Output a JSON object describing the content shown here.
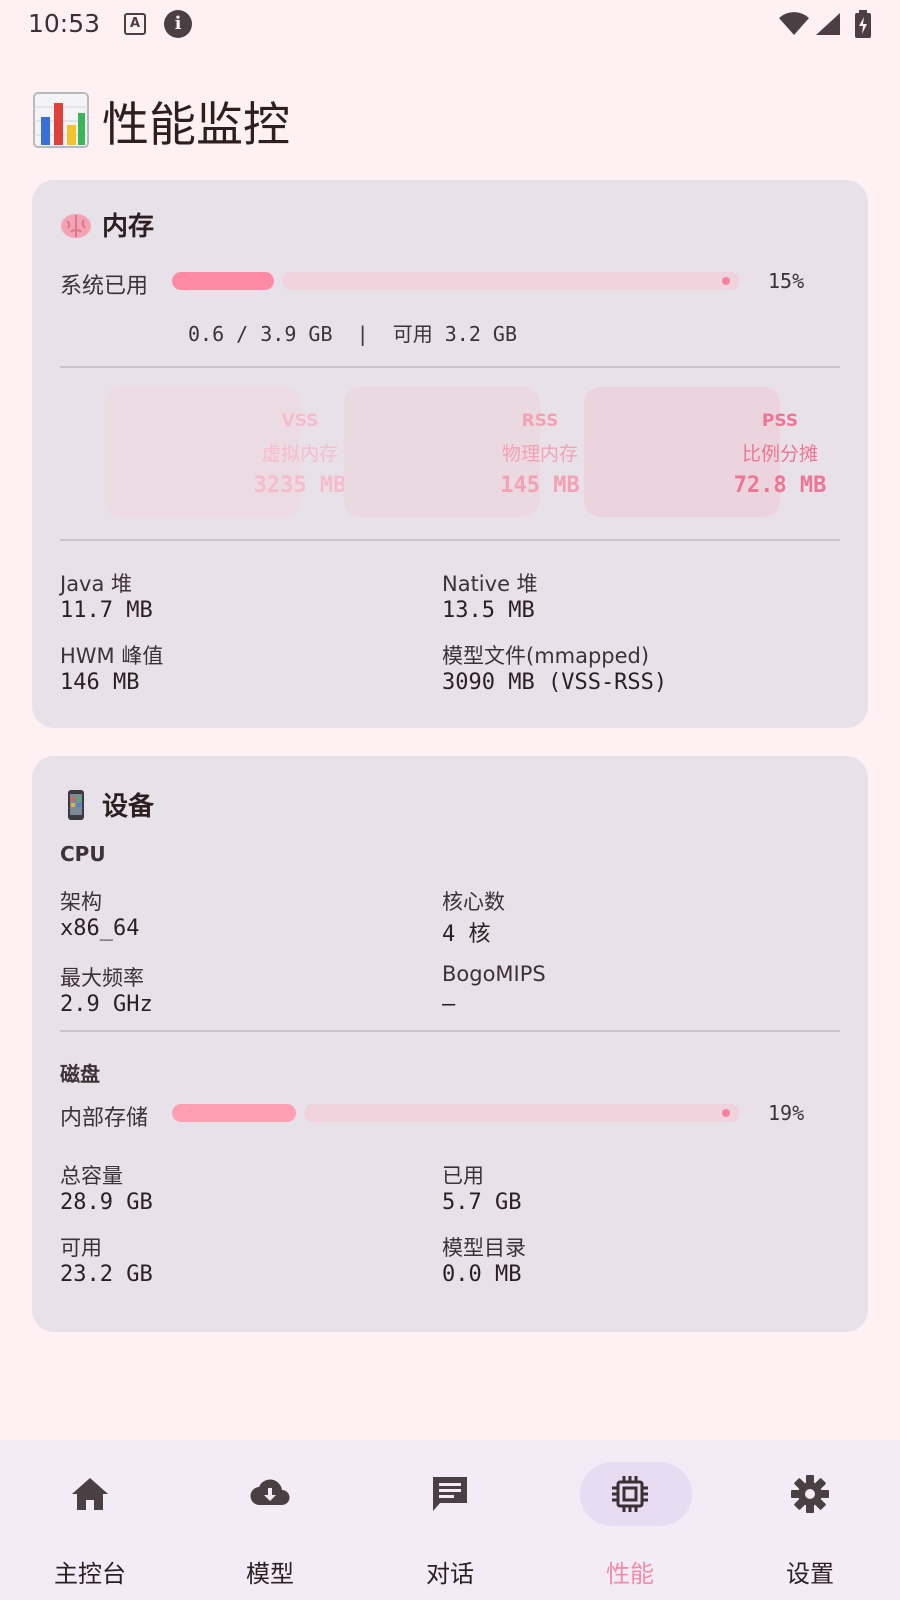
{
  "status_bar": {
    "time": "10:53",
    "a_badge": "A",
    "info_glyph": "i",
    "icons": [
      "a-notification-icon",
      "info-icon",
      "wifi-icon",
      "signal-icon",
      "battery-charging-icon"
    ]
  },
  "page": {
    "title": "性能监控",
    "title_icon": "bar-chart-icon"
  },
  "memory": {
    "header": "内存",
    "header_icon": "brain-icon",
    "system_used_label": "系统已用",
    "system_used_percent": 15,
    "system_used_pct_text": "15%",
    "summary": "0.6 / 3.9 GB  |  可用 3.2 GB",
    "stats": [
      {
        "abbr": "VSS",
        "name": "虚拟内存",
        "value": "3235 MB"
      },
      {
        "abbr": "RSS",
        "name": "物理内存",
        "value": "145 MB"
      },
      {
        "abbr": "PSS",
        "name": "比例分摊",
        "value": "72.8 MB"
      }
    ],
    "details": [
      {
        "label": "Java 堆",
        "value": "11.7 MB"
      },
      {
        "label": "Native 堆",
        "value": "13.5 MB"
      },
      {
        "label": "HWM 峰值",
        "value": "146 MB"
      },
      {
        "label": "模型文件(mmapped)",
        "value": "3090 MB (VSS-RSS)"
      }
    ]
  },
  "device": {
    "header": "设备",
    "header_icon": "phone-icon",
    "cpu_label": "CPU",
    "cpu": [
      {
        "label": "架构",
        "value": "x86_64"
      },
      {
        "label": "核心数",
        "value": "4 核"
      },
      {
        "label": "最大频率",
        "value": "2.9 GHz"
      },
      {
        "label": "BogoMIPS",
        "value": "—"
      }
    ],
    "disk_label": "磁盘",
    "internal_storage_label": "内部存储",
    "internal_storage_percent": 19,
    "internal_storage_pct_text": "19%",
    "disk": [
      {
        "label": "总容量",
        "value": "28.9 GB"
      },
      {
        "label": "已用",
        "value": "5.7 GB"
      },
      {
        "label": "可用",
        "value": "23.2 GB"
      },
      {
        "label": "模型目录",
        "value": "0.0 MB"
      }
    ]
  },
  "nav": {
    "items": [
      {
        "label": "主控台",
        "icon": "home-icon"
      },
      {
        "label": "模型",
        "icon": "cloud-download-icon"
      },
      {
        "label": "对话",
        "icon": "chat-icon"
      },
      {
        "label": "性能",
        "icon": "cpu-chip-icon",
        "active": true
      },
      {
        "label": "设置",
        "icon": "settings-gear-icon"
      }
    ]
  },
  "colors": {
    "background": "#fff0f4",
    "card": "#e8e1e9",
    "accent": "#ff8aa4",
    "active_nav": "#f48ca8"
  }
}
